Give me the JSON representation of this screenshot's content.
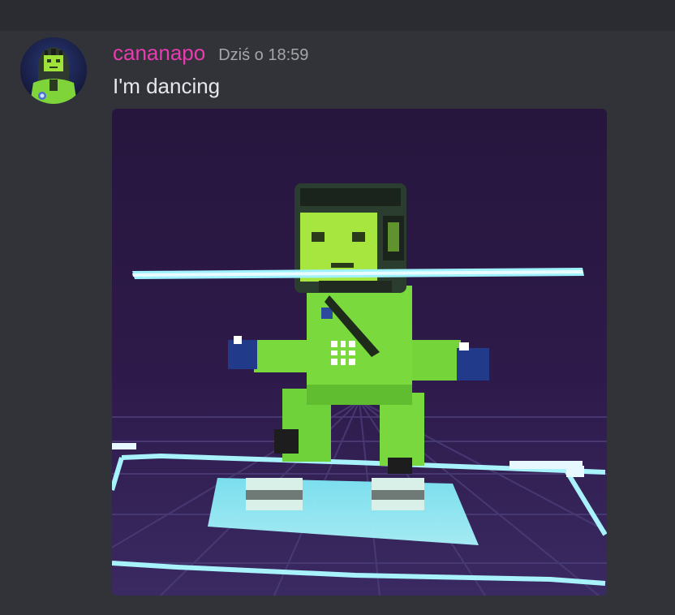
{
  "message": {
    "author": "cananapo",
    "timestamp": "Dziś o 18:59",
    "content": "I'm dancing",
    "author_color": "#e93bb0"
  },
  "attachment": {
    "kind": "image",
    "subject": "voxel character dancing on neon grid"
  },
  "icons": {
    "avatar": "user-avatar-icon"
  }
}
